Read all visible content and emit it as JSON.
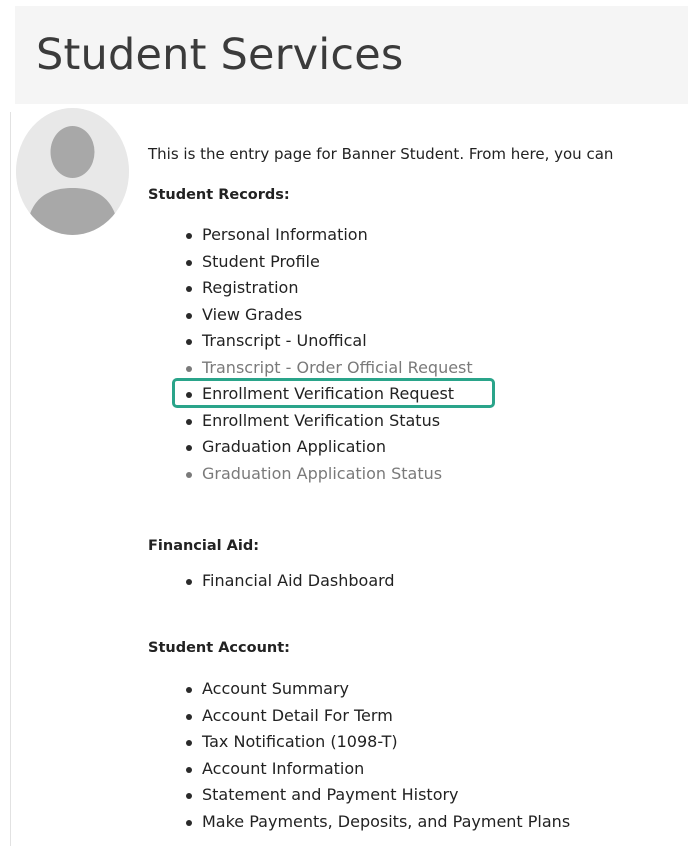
{
  "page": {
    "title": "Student Services",
    "intro": "This is the entry page for Banner Student. From here, you can"
  },
  "sections": [
    {
      "heading": "Student Records:",
      "items": [
        {
          "label": "Personal Information",
          "muted": false
        },
        {
          "label": "Student Profile",
          "muted": false
        },
        {
          "label": "Registration",
          "muted": false
        },
        {
          "label": "View Grades",
          "muted": false
        },
        {
          "label": "Transcript - Unoffical",
          "muted": false
        },
        {
          "label": "Transcript - Order Official Request",
          "muted": true
        },
        {
          "label": "Enrollment Verification Request",
          "muted": false,
          "highlighted": true
        },
        {
          "label": "Enrollment Verification Status",
          "muted": false
        },
        {
          "label": "Graduation Application",
          "muted": false
        },
        {
          "label": "Graduation Application Status",
          "muted": true
        }
      ]
    },
    {
      "heading": "Financial Aid:",
      "items": [
        {
          "label": "Financial Aid Dashboard",
          "muted": false
        }
      ]
    },
    {
      "heading": "Student Account:",
      "items": [
        {
          "label": "Account Summary",
          "muted": false
        },
        {
          "label": "Account Detail For Term",
          "muted": false
        },
        {
          "label": "Tax Notification (1098-T)",
          "muted": false
        },
        {
          "label": "Account Information",
          "muted": false
        },
        {
          "label": "Statement and Payment History",
          "muted": false
        },
        {
          "label": "Make Payments, Deposits, and Payment Plans",
          "muted": false
        }
      ]
    }
  ],
  "colors": {
    "highlight": "#2aa48a",
    "muted_text": "#7a7a7a",
    "title_bar": "#f5f5f5"
  },
  "icons": {
    "avatar": "user-silhouette-icon"
  }
}
